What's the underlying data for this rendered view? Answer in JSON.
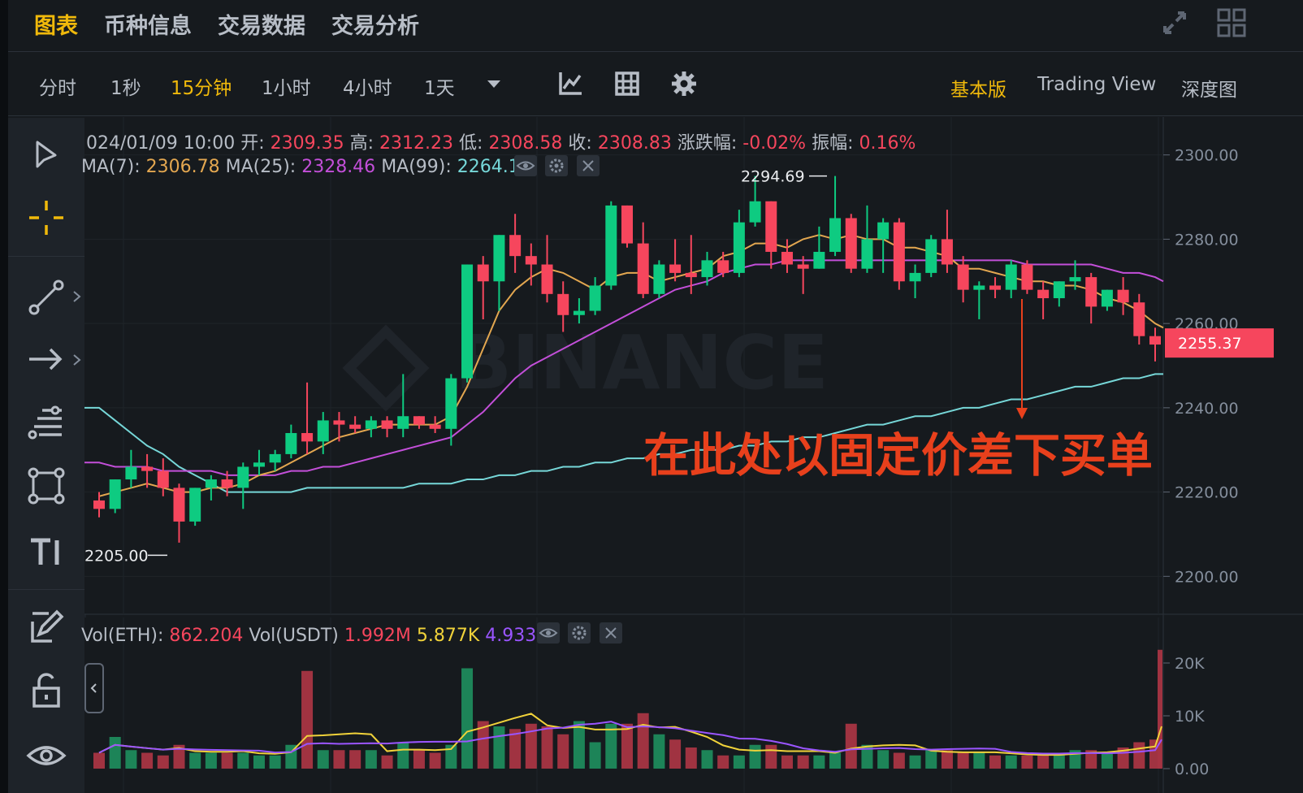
{
  "tabs": [
    {
      "label": "图表",
      "active": true
    },
    {
      "label": "币种信息",
      "active": false
    },
    {
      "label": "交易数据",
      "active": false
    },
    {
      "label": "交易分析",
      "active": false
    }
  ],
  "intervals": [
    {
      "label": "分时",
      "active": false
    },
    {
      "label": "1秒",
      "active": false
    },
    {
      "label": "15分钟",
      "active": true
    },
    {
      "label": "1小时",
      "active": false
    },
    {
      "label": "4小时",
      "active": false
    },
    {
      "label": "1天",
      "active": false
    }
  ],
  "views": [
    {
      "label": "基本版",
      "active": true
    },
    {
      "label": "Trading View",
      "active": false
    },
    {
      "label": "深度图",
      "active": false
    }
  ],
  "ohlc": {
    "date": "024/01/09 10:00",
    "open_label": "开:",
    "open": "2309.35",
    "high_label": "高:",
    "high": "2312.23",
    "low_label": "低:",
    "low": "2308.58",
    "close_label": "收:",
    "close": "2308.83",
    "change_label": "涨跌幅:",
    "change": "-0.02%",
    "amplitude_label": "振幅:",
    "amplitude": "0.16%"
  },
  "ma": {
    "ma7_label": "MA(7):",
    "ma7": "2306.78",
    "ma25_label": "MA(25):",
    "ma25": "2328.46",
    "ma99_label": "MA(99):",
    "ma99": "2264.18"
  },
  "volume_info": {
    "vol_eth_label": "Vol(ETH):",
    "vol_eth": "862.204",
    "vol_usdt_label": "Vol(USDT)",
    "vol_usdt": "1.992M",
    "vol_ma1": "5.877K",
    "vol_ma2": "4.933K"
  },
  "current_price": "2255.37",
  "high_marker": "2294.69",
  "low_marker": "2205.00",
  "annotation": "在此处以固定价差下买单",
  "watermark": "BINANCE",
  "colors": {
    "up": "#0ecb81",
    "down": "#f6465d",
    "accent": "#f0b90b",
    "ma7": "#e3a750",
    "ma25": "#c34fd9",
    "ma99": "#76d7d8",
    "annotation": "#e8401c"
  },
  "chart_data": {
    "type": "candlestick",
    "price_axis": {
      "ticks": [
        "2300.00",
        "2280.00",
        "2260.00",
        "2240.00",
        "2220.00",
        "2200.00"
      ],
      "ylim": [
        2191,
        2309
      ]
    },
    "volume_axis": {
      "ticks": [
        "20K",
        "10K",
        "0.00"
      ],
      "ylim": [
        0,
        24000
      ]
    },
    "candles": [
      [
        2218,
        2220,
        2214,
        2216
      ],
      [
        2216,
        2223,
        2215,
        2223
      ],
      [
        2223,
        2230,
        2221,
        2226
      ],
      [
        2226,
        2229,
        2221,
        2225
      ],
      [
        2225,
        2228,
        2219,
        2221
      ],
      [
        2221,
        2222,
        2208,
        2213
      ],
      [
        2213,
        2221,
        2212,
        2221
      ],
      [
        2221,
        2224,
        2218,
        2223
      ],
      [
        2223,
        2225,
        2219,
        2221
      ],
      [
        2221,
        2227,
        2216,
        2226
      ],
      [
        2226,
        2230,
        2224,
        2227
      ],
      [
        2227,
        2230,
        2225,
        2229
      ],
      [
        2229,
        2236,
        2228,
        2234
      ],
      [
        2234,
        2246,
        2229,
        2232
      ],
      [
        2232,
        2239,
        2229,
        2237
      ],
      [
        2237,
        2239,
        2232,
        2236
      ],
      [
        2236,
        2238,
        2234,
        2235
      ],
      [
        2235,
        2238,
        2233,
        2237
      ],
      [
        2237,
        2238,
        2233,
        2235
      ],
      [
        2235,
        2248,
        2233,
        2238
      ],
      [
        2238,
        2238,
        2235,
        2236
      ],
      [
        2236,
        2238,
        2234,
        2235
      ],
      [
        2235,
        2248,
        2231,
        2247
      ],
      [
        2247,
        2274,
        2246,
        2274
      ],
      [
        2274,
        2276,
        2261,
        2270
      ],
      [
        2270,
        2281,
        2263,
        2281
      ],
      [
        2281,
        2286,
        2272,
        2276
      ],
      [
        2276,
        2279,
        2269,
        2274
      ],
      [
        2274,
        2281,
        2265,
        2267
      ],
      [
        2267,
        2270,
        2258,
        2262
      ],
      [
        2262,
        2266,
        2260,
        2263
      ],
      [
        2263,
        2271,
        2262,
        2269
      ],
      [
        2269,
        2289,
        2268,
        2288
      ],
      [
        2288,
        2288,
        2278,
        2279
      ],
      [
        2279,
        2284,
        2266,
        2267
      ],
      [
        2267,
        2275,
        2266,
        2274
      ],
      [
        2274,
        2280,
        2270,
        2272
      ],
      [
        2272,
        2281,
        2267,
        2271
      ],
      [
        2271,
        2277,
        2269,
        2275
      ],
      [
        2275,
        2277,
        2271,
        2272
      ],
      [
        2272,
        2287,
        2271,
        2284
      ],
      [
        2284,
        2295,
        2283,
        2289
      ],
      [
        2289,
        2289,
        2273,
        2277
      ],
      [
        2277,
        2280,
        2272,
        2274
      ],
      [
        2274,
        2276,
        2267,
        2273
      ],
      [
        2273,
        2283,
        2273,
        2277
      ],
      [
        2277,
        2295,
        2276,
        2285
      ],
      [
        2285,
        2286,
        2272,
        2273
      ],
      [
        2273,
        2288,
        2272,
        2280
      ],
      [
        2280,
        2285,
        2272,
        2284
      ],
      [
        2284,
        2285,
        2268,
        2270
      ],
      [
        2270,
        2274,
        2266,
        2272
      ],
      [
        2272,
        2281,
        2271,
        2280
      ],
      [
        2280,
        2287,
        2272,
        2274
      ],
      [
        2274,
        2276,
        2265,
        2268
      ],
      [
        2268,
        2270,
        2261,
        2269
      ],
      [
        2269,
        2271,
        2266,
        2268
      ],
      [
        2268,
        2275,
        2266,
        2274
      ],
      [
        2274,
        2275,
        2267,
        2268
      ],
      [
        2268,
        2270,
        2261,
        2266
      ],
      [
        2266,
        2270,
        2264,
        2270
      ],
      [
        2270,
        2275,
        2268,
        2271
      ],
      [
        2271,
        2272,
        2260,
        2264
      ],
      [
        2264,
        2268,
        2263,
        2268
      ],
      [
        2268,
        2271,
        2262,
        2265
      ],
      [
        2265,
        2267,
        2255,
        2257
      ],
      [
        2257,
        2259,
        2251,
        2255
      ]
    ],
    "volumes": [
      3000,
      6000,
      3500,
      3000,
      2500,
      4500,
      3000,
      3000,
      3000,
      3000,
      2500,
      2500,
      4500,
      18500,
      3500,
      3500,
      3500,
      3500,
      2500,
      5000,
      3500,
      3000,
      4500,
      19000,
      9000,
      8000,
      7500,
      8500,
      8000,
      6500,
      9000,
      5000,
      8500,
      8500,
      10500,
      6500,
      5500,
      4000,
      3500,
      2500,
      2500,
      4500,
      4500,
      2500,
      2500,
      2500,
      3000,
      8500,
      4500,
      3500,
      3000,
      2500,
      3500,
      3500,
      3000,
      3000,
      2500,
      2500,
      2500,
      2500,
      3000,
      3500,
      3500,
      3000,
      4000,
      5000,
      5500,
      22500
    ],
    "ma7": [
      2219,
      2220,
      2221,
      2222,
      2221,
      2220,
      2220,
      2221,
      2221,
      2222,
      2224,
      2225,
      2227,
      2229,
      2231,
      2233,
      2234,
      2235,
      2236,
      2236,
      2236,
      2236,
      2238,
      2245,
      2254,
      2263,
      2268,
      2271,
      2273,
      2272,
      2270,
      2268,
      2271,
      2272,
      2272,
      2270,
      2271,
      2272,
      2273,
      2276,
      2277,
      2279,
      2279,
      2278,
      2280,
      2281,
      2280,
      2281,
      2280,
      2280,
      2278,
      2278,
      2277,
      2276,
      2273,
      2273,
      2272,
      2271,
      2270,
      2270,
      2269,
      2269,
      2268,
      2266,
      2265,
      2263,
      2260
    ],
    "ma25": [
      2227,
      2226,
      2226,
      2226,
      2225,
      2225,
      2225,
      2225,
      2224,
      2224,
      2224,
      2224,
      2225,
      2225,
      2226,
      2226,
      2227,
      2228,
      2229,
      2230,
      2231,
      2232,
      2233,
      2236,
      2239,
      2243,
      2247,
      2250,
      2252,
      2254,
      2256,
      2258,
      2260,
      2262,
      2264,
      2266,
      2268,
      2269,
      2270,
      2272,
      2273,
      2274,
      2274,
      2275,
      2275,
      2275,
      2275,
      2275,
      2275,
      2275,
      2275,
      2275,
      2275,
      2275,
      2275,
      2275,
      2275,
      2275,
      2274,
      2274,
      2274,
      2274,
      2274,
      2273,
      2272,
      2272,
      2271
    ],
    "ma99": [
      2240,
      2237,
      2234,
      2231,
      2229,
      2226,
      2224,
      2222,
      2220,
      2220,
      2220,
      2220,
      2220,
      2221,
      2221,
      2221,
      2221,
      2221,
      2221,
      2221,
      2222,
      2222,
      2222,
      2223,
      2223,
      2224,
      2224,
      2225,
      2225,
      2226,
      2226,
      2227,
      2227,
      2228,
      2228,
      2229,
      2229,
      2230,
      2230,
      2230,
      2231,
      2231,
      2232,
      2232,
      2233,
      2233,
      2234,
      2235,
      2236,
      2236,
      2237,
      2238,
      2238,
      2239,
      2240,
      2240,
      2241,
      2242,
      2242,
      2243,
      2244,
      2245,
      2245,
      2246,
      2247,
      2247,
      2248
    ]
  }
}
